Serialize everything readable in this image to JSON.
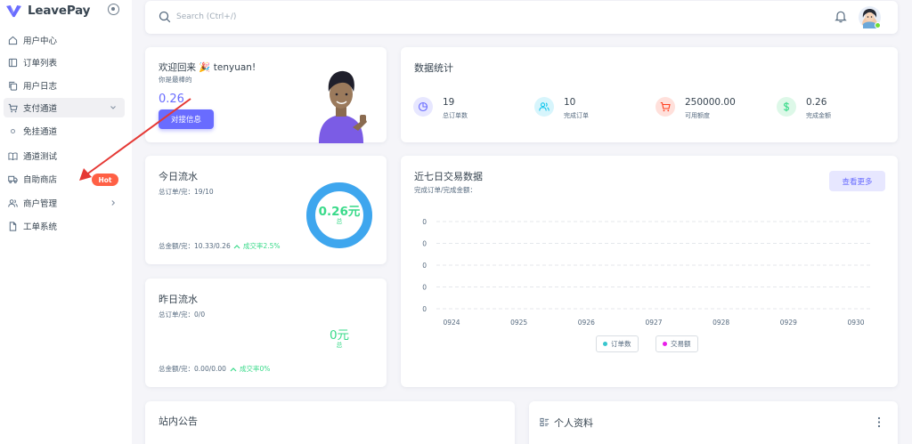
{
  "app": {
    "name": "LeavePay"
  },
  "sidebar": {
    "items": [
      {
        "label": "用户中心"
      },
      {
        "label": "订单列表"
      },
      {
        "label": "用户日志"
      },
      {
        "label": "支付通道"
      },
      {
        "label": "免挂通道"
      },
      {
        "label": "通道测试"
      },
      {
        "label": "自助商店",
        "badge": "Hot"
      },
      {
        "label": "商户管理"
      },
      {
        "label": "工单系统"
      }
    ]
  },
  "search": {
    "placeholder": "Search (Ctrl+/)"
  },
  "welcome": {
    "greeting": "欢迎回来 🎉 tenyuan!",
    "subtitle": "你是最棒的",
    "amount": "0.26",
    "button": "对接信息"
  },
  "stats": {
    "title": "数据统计",
    "items": [
      {
        "value": "19",
        "label": "总订单数"
      },
      {
        "value": "10",
        "label": "完成订单"
      },
      {
        "value": "250000.00",
        "label": "可用额度"
      },
      {
        "value": "0.26",
        "label": "完成金额"
      }
    ]
  },
  "today": {
    "title": "今日流水",
    "orders": "总订单/完：19/10",
    "ring_value": "0.26元",
    "ring_label": "总",
    "amount": "总金额/完：10.33/0.26",
    "rate": "成交率2.5%",
    "completion_fraction": 1
  },
  "yesterday": {
    "title": "昨日流水",
    "orders": "总订单/完：0/0",
    "value": "0元",
    "value_label": "总",
    "amount": "总金额/完：0.00/0.00",
    "rate": "成交率0%"
  },
  "weekly": {
    "title": "近七日交易数据",
    "subtitle": "完成订单/完成金额：",
    "button": "查看更多"
  },
  "notice": {
    "title": "站内公告"
  },
  "profile": {
    "title": "个人资料"
  },
  "colors": {
    "primary": "#696cff",
    "success": "#39da8a",
    "info": "#03c3ec",
    "danger": "#ff3e1d",
    "ring": "#3ea6ee"
  },
  "chart_data": {
    "type": "line",
    "title": "近七日交易数据",
    "categories": [
      "0924",
      "0925",
      "0926",
      "0927",
      "0928",
      "0929",
      "0930"
    ],
    "y_ticks": [
      "0",
      "0",
      "0",
      "0",
      "0"
    ],
    "series": [
      {
        "name": "订单数",
        "values": [
          0,
          0,
          0,
          0,
          0,
          0,
          0
        ],
        "color": "#39c6ce"
      },
      {
        "name": "交易额",
        "values": [
          0,
          0,
          0,
          0,
          0,
          0,
          0
        ],
        "color": "#e91ee9"
      }
    ],
    "grid": true,
    "legend": "bottom"
  }
}
